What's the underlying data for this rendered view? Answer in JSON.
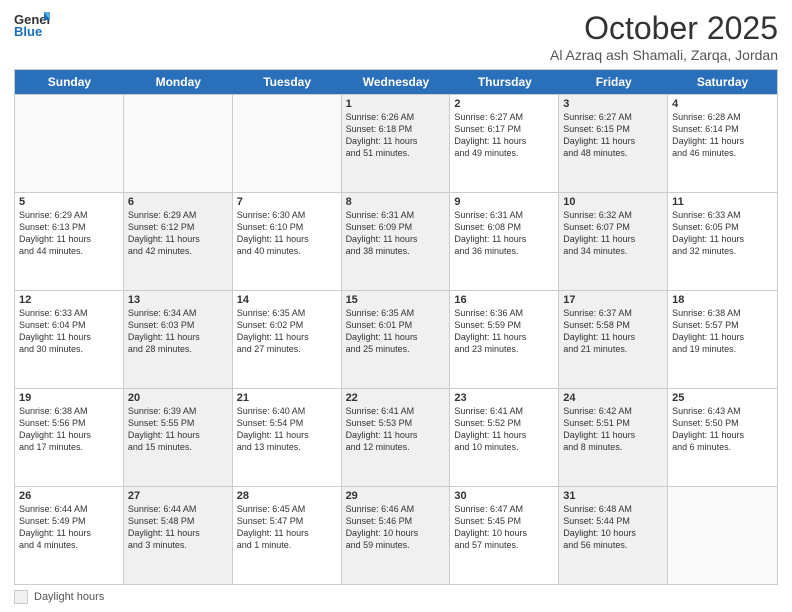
{
  "header": {
    "logo_general": "General",
    "logo_blue": "Blue",
    "month_title": "October 2025",
    "location": "Al Azraq ash Shamali, Zarqa, Jordan"
  },
  "days_of_week": [
    "Sunday",
    "Monday",
    "Tuesday",
    "Wednesday",
    "Thursday",
    "Friday",
    "Saturday"
  ],
  "weeks": [
    [
      {
        "day": "",
        "info": "",
        "empty": true
      },
      {
        "day": "",
        "info": "",
        "empty": true
      },
      {
        "day": "",
        "info": "",
        "empty": true
      },
      {
        "day": "1",
        "info": "Sunrise: 6:26 AM\nSunset: 6:18 PM\nDaylight: 11 hours\nand 51 minutes.",
        "shaded": true
      },
      {
        "day": "2",
        "info": "Sunrise: 6:27 AM\nSunset: 6:17 PM\nDaylight: 11 hours\nand 49 minutes."
      },
      {
        "day": "3",
        "info": "Sunrise: 6:27 AM\nSunset: 6:15 PM\nDaylight: 11 hours\nand 48 minutes.",
        "shaded": true
      },
      {
        "day": "4",
        "info": "Sunrise: 6:28 AM\nSunset: 6:14 PM\nDaylight: 11 hours\nand 46 minutes."
      }
    ],
    [
      {
        "day": "5",
        "info": "Sunrise: 6:29 AM\nSunset: 6:13 PM\nDaylight: 11 hours\nand 44 minutes."
      },
      {
        "day": "6",
        "info": "Sunrise: 6:29 AM\nSunset: 6:12 PM\nDaylight: 11 hours\nand 42 minutes.",
        "shaded": true
      },
      {
        "day": "7",
        "info": "Sunrise: 6:30 AM\nSunset: 6:10 PM\nDaylight: 11 hours\nand 40 minutes."
      },
      {
        "day": "8",
        "info": "Sunrise: 6:31 AM\nSunset: 6:09 PM\nDaylight: 11 hours\nand 38 minutes.",
        "shaded": true
      },
      {
        "day": "9",
        "info": "Sunrise: 6:31 AM\nSunset: 6:08 PM\nDaylight: 11 hours\nand 36 minutes."
      },
      {
        "day": "10",
        "info": "Sunrise: 6:32 AM\nSunset: 6:07 PM\nDaylight: 11 hours\nand 34 minutes.",
        "shaded": true
      },
      {
        "day": "11",
        "info": "Sunrise: 6:33 AM\nSunset: 6:05 PM\nDaylight: 11 hours\nand 32 minutes."
      }
    ],
    [
      {
        "day": "12",
        "info": "Sunrise: 6:33 AM\nSunset: 6:04 PM\nDaylight: 11 hours\nand 30 minutes."
      },
      {
        "day": "13",
        "info": "Sunrise: 6:34 AM\nSunset: 6:03 PM\nDaylight: 11 hours\nand 28 minutes.",
        "shaded": true
      },
      {
        "day": "14",
        "info": "Sunrise: 6:35 AM\nSunset: 6:02 PM\nDaylight: 11 hours\nand 27 minutes."
      },
      {
        "day": "15",
        "info": "Sunrise: 6:35 AM\nSunset: 6:01 PM\nDaylight: 11 hours\nand 25 minutes.",
        "shaded": true
      },
      {
        "day": "16",
        "info": "Sunrise: 6:36 AM\nSunset: 5:59 PM\nDaylight: 11 hours\nand 23 minutes."
      },
      {
        "day": "17",
        "info": "Sunrise: 6:37 AM\nSunset: 5:58 PM\nDaylight: 11 hours\nand 21 minutes.",
        "shaded": true
      },
      {
        "day": "18",
        "info": "Sunrise: 6:38 AM\nSunset: 5:57 PM\nDaylight: 11 hours\nand 19 minutes."
      }
    ],
    [
      {
        "day": "19",
        "info": "Sunrise: 6:38 AM\nSunset: 5:56 PM\nDaylight: 11 hours\nand 17 minutes."
      },
      {
        "day": "20",
        "info": "Sunrise: 6:39 AM\nSunset: 5:55 PM\nDaylight: 11 hours\nand 15 minutes.",
        "shaded": true
      },
      {
        "day": "21",
        "info": "Sunrise: 6:40 AM\nSunset: 5:54 PM\nDaylight: 11 hours\nand 13 minutes."
      },
      {
        "day": "22",
        "info": "Sunrise: 6:41 AM\nSunset: 5:53 PM\nDaylight: 11 hours\nand 12 minutes.",
        "shaded": true
      },
      {
        "day": "23",
        "info": "Sunrise: 6:41 AM\nSunset: 5:52 PM\nDaylight: 11 hours\nand 10 minutes."
      },
      {
        "day": "24",
        "info": "Sunrise: 6:42 AM\nSunset: 5:51 PM\nDaylight: 11 hours\nand 8 minutes.",
        "shaded": true
      },
      {
        "day": "25",
        "info": "Sunrise: 6:43 AM\nSunset: 5:50 PM\nDaylight: 11 hours\nand 6 minutes."
      }
    ],
    [
      {
        "day": "26",
        "info": "Sunrise: 6:44 AM\nSunset: 5:49 PM\nDaylight: 11 hours\nand 4 minutes."
      },
      {
        "day": "27",
        "info": "Sunrise: 6:44 AM\nSunset: 5:48 PM\nDaylight: 11 hours\nand 3 minutes.",
        "shaded": true
      },
      {
        "day": "28",
        "info": "Sunrise: 6:45 AM\nSunset: 5:47 PM\nDaylight: 11 hours\nand 1 minute."
      },
      {
        "day": "29",
        "info": "Sunrise: 6:46 AM\nSunset: 5:46 PM\nDaylight: 10 hours\nand 59 minutes.",
        "shaded": true
      },
      {
        "day": "30",
        "info": "Sunrise: 6:47 AM\nSunset: 5:45 PM\nDaylight: 10 hours\nand 57 minutes."
      },
      {
        "day": "31",
        "info": "Sunrise: 6:48 AM\nSunset: 5:44 PM\nDaylight: 10 hours\nand 56 minutes.",
        "shaded": true
      },
      {
        "day": "",
        "info": "",
        "empty": true
      }
    ]
  ],
  "footer": {
    "daylight_label": "Daylight hours"
  }
}
